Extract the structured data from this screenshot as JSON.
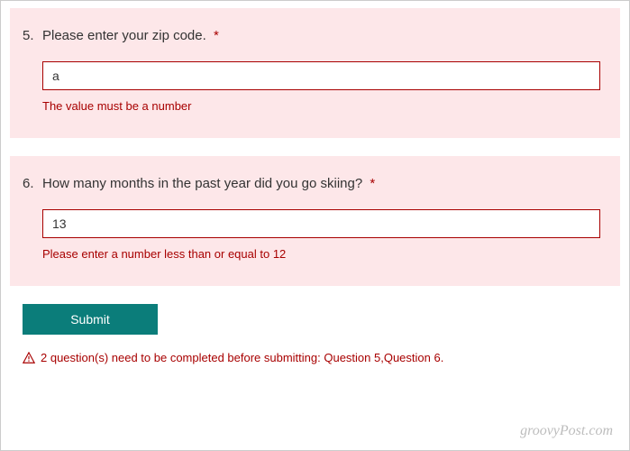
{
  "questions": [
    {
      "number": "5.",
      "text": "Please enter your zip code.",
      "required_mark": "*",
      "value": "a",
      "error": "The value must be a number"
    },
    {
      "number": "6.",
      "text": "How many months in the past year did you go skiing?",
      "required_mark": "*",
      "value": "13",
      "error": "Please enter a number less than or equal to 12"
    }
  ],
  "submit_label": "Submit",
  "footer_error": "2 question(s) need to be completed before submitting: Question 5,Question 6.",
  "watermark": "groovyPost.com"
}
